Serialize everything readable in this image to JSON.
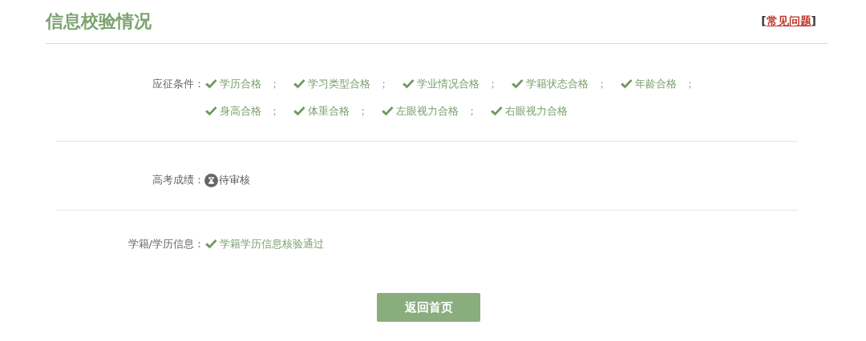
{
  "header": {
    "title": "信息校验情况",
    "link": {
      "open": "[",
      "label": "常见问题",
      "close": "]"
    }
  },
  "rows": [
    {
      "label": "应征条件：",
      "items": [
        {
          "kind": "pass",
          "text": "学历合格",
          "suffix": "；"
        },
        {
          "kind": "pass",
          "text": "学习类型合格",
          "suffix": "；"
        },
        {
          "kind": "pass",
          "text": "学业情况合格",
          "suffix": "；"
        },
        {
          "kind": "pass",
          "text": "学籍状态合格",
          "suffix": "；"
        },
        {
          "kind": "pass",
          "text": "年龄合格",
          "suffix": "；"
        },
        {
          "kind": "pass",
          "text": "身高合格",
          "suffix": "；"
        },
        {
          "kind": "pass",
          "text": "体重合格",
          "suffix": "；"
        },
        {
          "kind": "pass",
          "text": "左眼视力合格",
          "suffix": "；"
        },
        {
          "kind": "pass",
          "text": "右眼视力合格"
        }
      ]
    },
    {
      "label": "高考成绩：",
      "items": [
        {
          "kind": "pending",
          "text": "待审核"
        }
      ]
    },
    {
      "label": "学籍/学历信息：",
      "items": [
        {
          "kind": "pass",
          "text": "学籍学历信息核验通过"
        }
      ]
    }
  ],
  "button": "返回首页"
}
